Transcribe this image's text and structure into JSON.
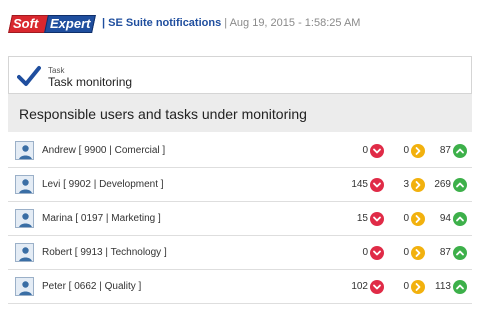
{
  "header": {
    "logo_left": "Soft",
    "logo_right": "Expert",
    "app_title": "| SE Suite notifications",
    "date": "| Aug 19, 2015 - 1:58:25 AM"
  },
  "task": {
    "label": "Task",
    "name": "Task monitoring"
  },
  "section": {
    "title": "Responsible users and tasks under monitoring"
  },
  "colors": {
    "overdue": "#e02b47",
    "pending": "#f2b10e",
    "ontime": "#3db04a",
    "brand_red": "#d9272e",
    "brand_blue": "#1f4e9e"
  },
  "users": [
    {
      "name": "Andrew [ 9900 | Comercial ]",
      "overdue": "0",
      "pending": "0",
      "ontime": "87"
    },
    {
      "name": "Levi [ 9902 | Development ]",
      "overdue": "145",
      "pending": "3",
      "ontime": "269"
    },
    {
      "name": "Marina [ 0197 | Marketing ]",
      "overdue": "15",
      "pending": "0",
      "ontime": "94"
    },
    {
      "name": "Robert [ 9913 | Technology ]",
      "overdue": "0",
      "pending": "0",
      "ontime": "87"
    },
    {
      "name": "Peter [ 0662 | Quality ]",
      "overdue": "102",
      "pending": "0",
      "ontime": "113"
    }
  ]
}
